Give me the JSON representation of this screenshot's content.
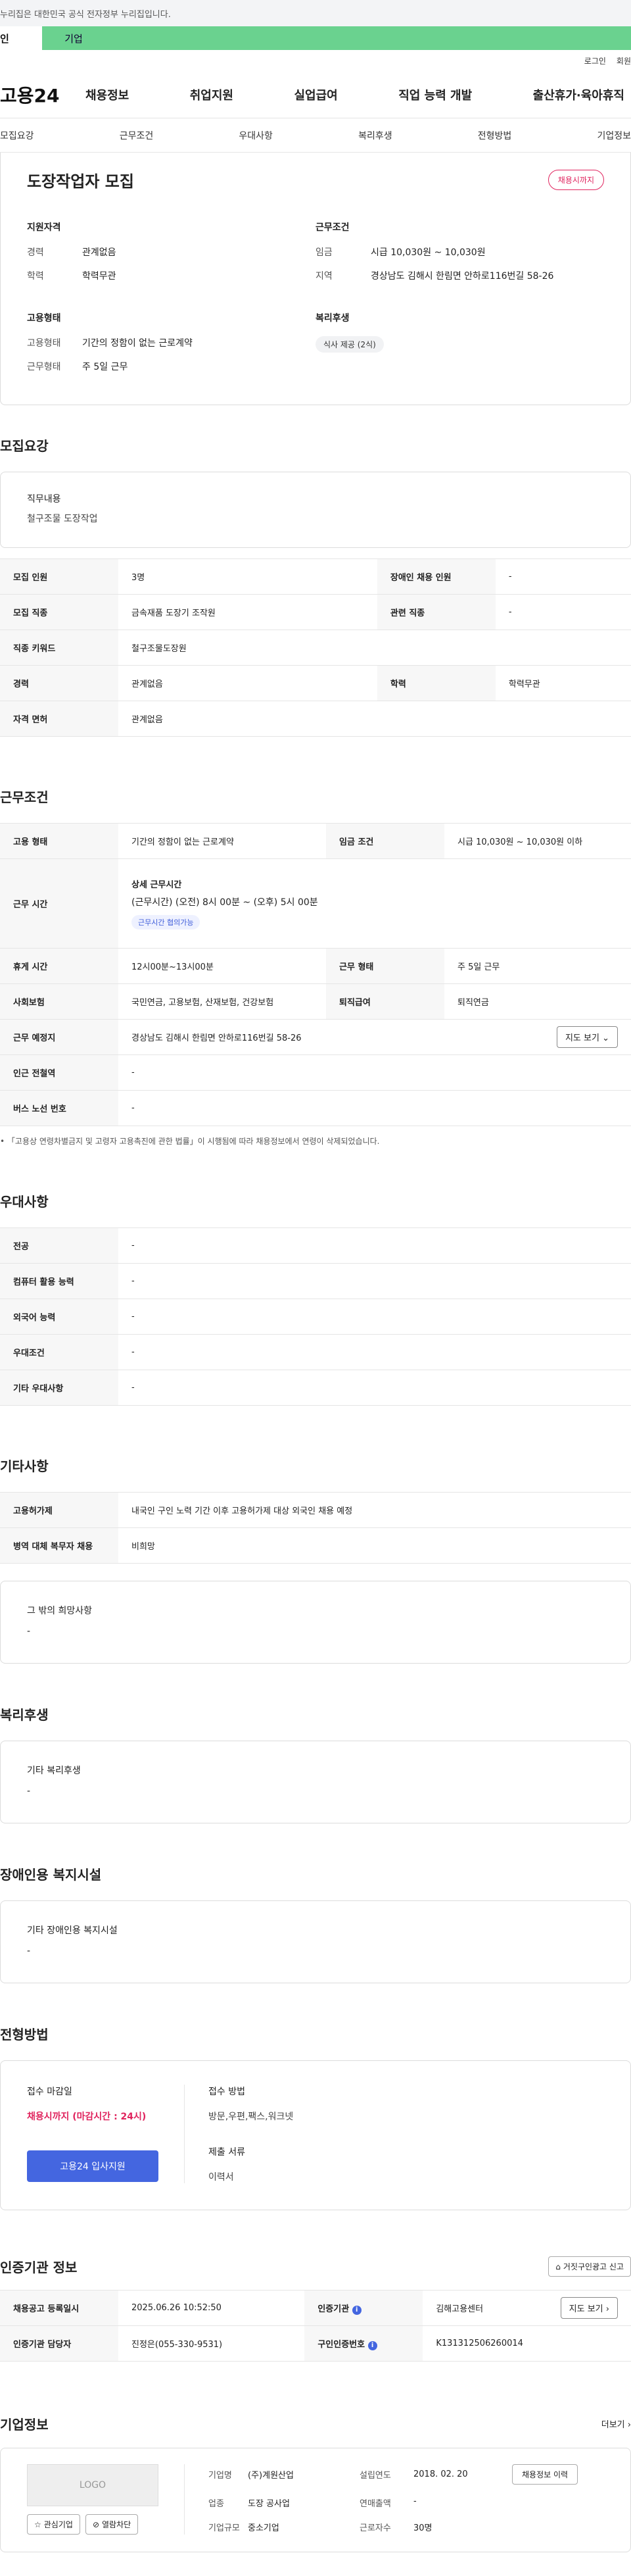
{
  "gov_banner": "누리집은 대한민국 공식 전자정부 누리집입니다.",
  "top_tabs": [
    "인",
    "기업"
  ],
  "util": [
    "로그인",
    "회원"
  ],
  "logo": "고용24",
  "gnb": [
    "채용정보",
    "취업지원",
    "실업급여",
    "직업 능력 개발",
    "출산휴가·육아휴직"
  ],
  "lnb": [
    "모집요강",
    "근무조건",
    "우대사항",
    "복리후생",
    "전형방법",
    "기업정보"
  ],
  "hero": {
    "title": "도장작업자 모집",
    "status": "채용시까지",
    "qual_h": "지원자격",
    "career_k": "경력",
    "career_v": "관계없음",
    "edu_k": "학력",
    "edu_v": "학력무관",
    "cond_h": "근무조건",
    "wage_k": "임금",
    "wage_v": "시급 10,030원 ~ 10,030원",
    "region_k": "지역",
    "region_v": "경상남도 김해시 한림면 안하로116번길 58-26",
    "emp_h": "고용형태",
    "emp_k": "고용형태",
    "emp_v": "기간의 정함이 없는 근로계약",
    "work_k": "근무형태",
    "work_v": "주 5일 근무",
    "welfare_h": "복리후생",
    "welfare_chip": "식사 제공 (2식)"
  },
  "recruit": {
    "title": "모집요강",
    "duty_h": "직무내용",
    "duty_v": "철구조물 도장작업",
    "rows": [
      {
        "k": "모집 인원",
        "v": "3명",
        "k2": "장애인 채용 인원",
        "v2": "-"
      },
      {
        "k": "모집 직종",
        "v": "금속재품 도장기 조작원",
        "k2": "관련 직종",
        "v2": "-"
      },
      {
        "k": "직종 키워드",
        "v": "철구조물도장원"
      },
      {
        "k": "경력",
        "v": "관계없음",
        "k2": "학력",
        "v2": "학력무관"
      },
      {
        "k": "자격 면허",
        "v": "관계없음"
      }
    ]
  },
  "work": {
    "title": "근무조건",
    "emp_k": "고용 형태",
    "emp_v": "기간의 정함이 없는 근로계약",
    "wage_k": "임금 조건",
    "wage_v": "시급 10,030원 ~ 10,030원 이하",
    "time_k": "근무 시간",
    "time_h": "상세 근무시간",
    "time_v": "(근무시간) (오전) 8시 00분 ~ (오후) 5시 00분",
    "time_chip": "근무시간 협의가능",
    "rest_k": "휴게 시간",
    "rest_v": "12시00분~13시00분",
    "type_k": "근무 형태",
    "type_v": "주 5일 근무",
    "ins_k": "사회보험",
    "ins_v": "국민연금, 고용보험, 산재보험, 건강보험",
    "ret_k": "퇴직급여",
    "ret_v": "퇴직연금",
    "place_k": "근무 예정지",
    "place_v": "경상남도 김해시 한림면 안하로116번길 58-26",
    "map_btn": "지도 보기",
    "station_k": "인근 전철역",
    "station_v": "-",
    "bus_k": "버스 노선 번호",
    "bus_v": "-",
    "note": "「고용상 연령차별금지 및 고령자 고용촉진에 관한 법률」이 시행됨에 따라 채용정보에서 연령이 삭제되었습니다."
  },
  "pref": {
    "title": "우대사항",
    "rows": [
      {
        "k": "전공",
        "v": "-"
      },
      {
        "k": "컴퓨터 활용 능력",
        "v": "-"
      },
      {
        "k": "외국어 능력",
        "v": "-"
      },
      {
        "k": "우대조건",
        "v": "-"
      },
      {
        "k": "기타 우대사항",
        "v": "-"
      }
    ]
  },
  "etc": {
    "title": "기타사항",
    "rows": [
      {
        "k": "고용허가제",
        "v": "내국인 구인 노력 기간 이후 고용허가제 대상 외국인 채용 예정"
      },
      {
        "k": "병역 대체 복무자 채용",
        "v": "비희망"
      }
    ],
    "hope_h": "그 밖의 희망사항",
    "hope_v": "-"
  },
  "benefit": {
    "title": "복리후생",
    "h": "기타 복리후생",
    "v": "-"
  },
  "disab": {
    "title": "장애인용 복지시설",
    "h": "기타 장애인용 복지시설",
    "v": "-"
  },
  "process": {
    "title": "전형방법",
    "deadline_h": "접수 마감일",
    "deadline_v": "채용시까지 (마감시간 : 24시)",
    "apply_btn": "고용24 입사지원",
    "method_h": "접수 방법",
    "method_v": "방문,우편,팩스,워크넷",
    "docs_h": "제출 서류",
    "docs_v": "이력서"
  },
  "cert": {
    "title": "인증기관 정보",
    "report_btn": "거짓구인광고 신고",
    "reg_k": "채용공고 등록일시",
    "reg_v": "2025.06.26 10:52:50",
    "org_k": "인증기관",
    "org_v": "김해고용센터",
    "map_btn": "지도 보기",
    "mgr_k": "인증기관 담당자",
    "mgr_v": "진정은(055-330-9531)",
    "id_k": "구인인증번호",
    "id_v": "K131312506260014"
  },
  "company": {
    "title": "기업정보",
    "more": "더보기",
    "logo_text": "LOGO",
    "fav_btn": "관심기업",
    "block_btn": "열람차단",
    "name_k": "기업명",
    "name_v": "(주)계원산업",
    "year_k": "설립연도",
    "year_v": "2018. 02. 20",
    "jobs_btn": "채용정보 이력",
    "ind_k": "업종",
    "ind_v": "도장 공사업",
    "sales_k": "연매출액",
    "sales_v": "-",
    "size_k": "기업규모",
    "size_v": "중소기업",
    "staff_k": "근로자수",
    "staff_v": "30명"
  }
}
